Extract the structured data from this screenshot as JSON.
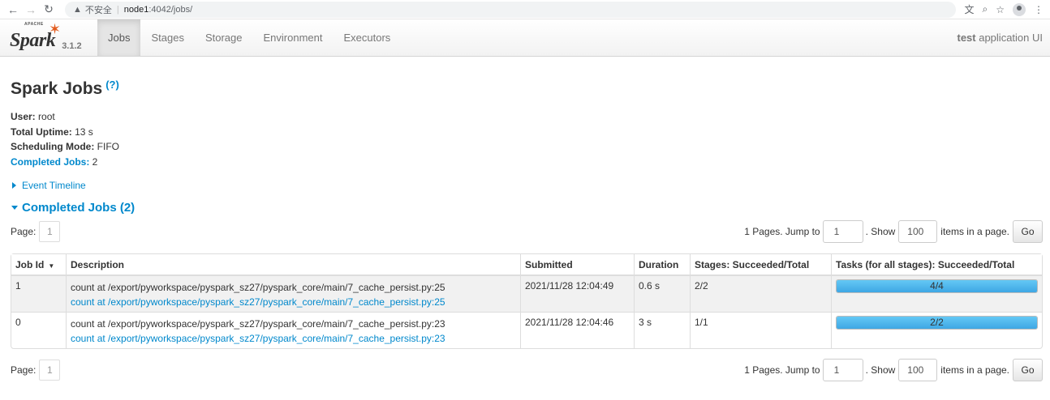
{
  "browser": {
    "insecure_label": "不安全",
    "host": "node1",
    "path": ":4042/jobs/"
  },
  "nav": {
    "logo_text": "Spark",
    "apache_text": "APACHE",
    "version": "3.1.2",
    "tabs": [
      "Jobs",
      "Stages",
      "Storage",
      "Environment",
      "Executors"
    ],
    "active_tab": "Jobs",
    "app_name_bold": "test",
    "app_name_rest": " application UI"
  },
  "page": {
    "title": "Spark Jobs",
    "help": "(?)",
    "summary": {
      "user_label": "User:",
      "user_value": " root",
      "uptime_label": "Total Uptime:",
      "uptime_value": " 13 s",
      "mode_label": "Scheduling Mode:",
      "mode_value": " FIFO",
      "completed_label": "Completed Jobs:",
      "completed_value": " 2"
    },
    "event_timeline": "Event Timeline",
    "completed_section": "Completed Jobs (2)"
  },
  "pager": {
    "page_label": "Page:",
    "page_value": "1",
    "pages_text": "1 Pages. Jump to",
    "jump_value": "1",
    "show_text": ". Show",
    "show_value": "100",
    "items_text": "items in a page.",
    "go_label": "Go"
  },
  "table": {
    "headers": {
      "job_id": "Job Id",
      "sort": "▼",
      "description": "Description",
      "submitted": "Submitted",
      "duration": "Duration",
      "stages": "Stages: Succeeded/Total",
      "tasks": "Tasks (for all stages): Succeeded/Total"
    },
    "rows": [
      {
        "job_id": "1",
        "desc_main": "count at /export/pyworkspace/pyspark_sz27/pyspark_core/main/7_cache_persist.py:25",
        "desc_link": "count at /export/pyworkspace/pyspark_sz27/pyspark_core/main/7_cache_persist.py:25",
        "submitted": "2021/11/28 12:04:49",
        "duration": "0.6 s",
        "stages": "2/2",
        "tasks": "4/4",
        "tasks_fraction": 1.0
      },
      {
        "job_id": "0",
        "desc_main": "count at /export/pyworkspace/pyspark_sz27/pyspark_core/main/7_cache_persist.py:23",
        "desc_link": "count at /export/pyworkspace/pyspark_sz27/pyspark_core/main/7_cache_persist.py:23",
        "submitted": "2021/11/28 12:04:46",
        "duration": "3 s",
        "stages": "1/1",
        "tasks": "2/2",
        "tasks_fraction": 1.0
      }
    ]
  },
  "colors": {
    "accent": "#0088cc",
    "spark_orange": "#e25a1c",
    "progress_bar": "#3ea7e4"
  }
}
